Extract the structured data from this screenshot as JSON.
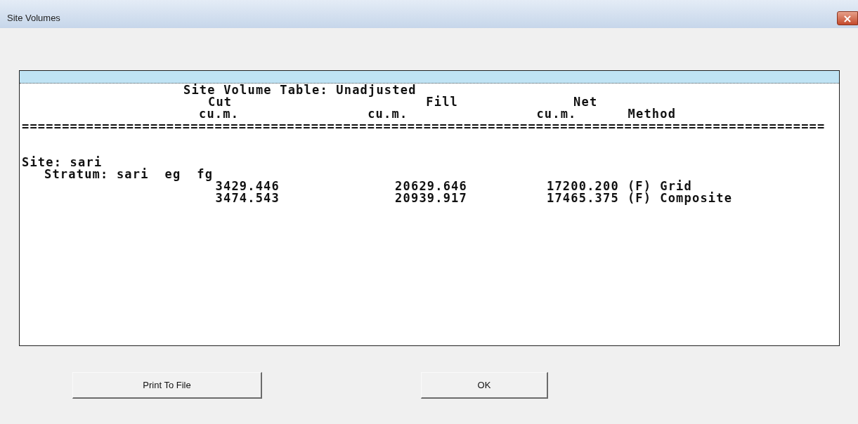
{
  "window": {
    "title": "Site Volumes",
    "close": "×"
  },
  "report": {
    "title": "Site Volume Table: Unadjusted",
    "headings": [
      "Cut",
      "Fill",
      "Net"
    ],
    "units": [
      "cu.m.",
      "cu.m.",
      "cu.m.",
      "Method"
    ],
    "separator": "====================================================================================================",
    "site": "Site: sari",
    "stratum": "Stratum: sari  eg  fg",
    "rows": [
      {
        "cut": "3429.446",
        "fill": "20629.646",
        "net": "17200.200",
        "flag": "(F)",
        "method": "Grid"
      },
      {
        "cut": "3474.543",
        "fill": "20939.917",
        "net": "17465.375",
        "flag": "(F)",
        "method": "Composite"
      }
    ]
  },
  "buttons": [
    "Print To File",
    "OK"
  ]
}
